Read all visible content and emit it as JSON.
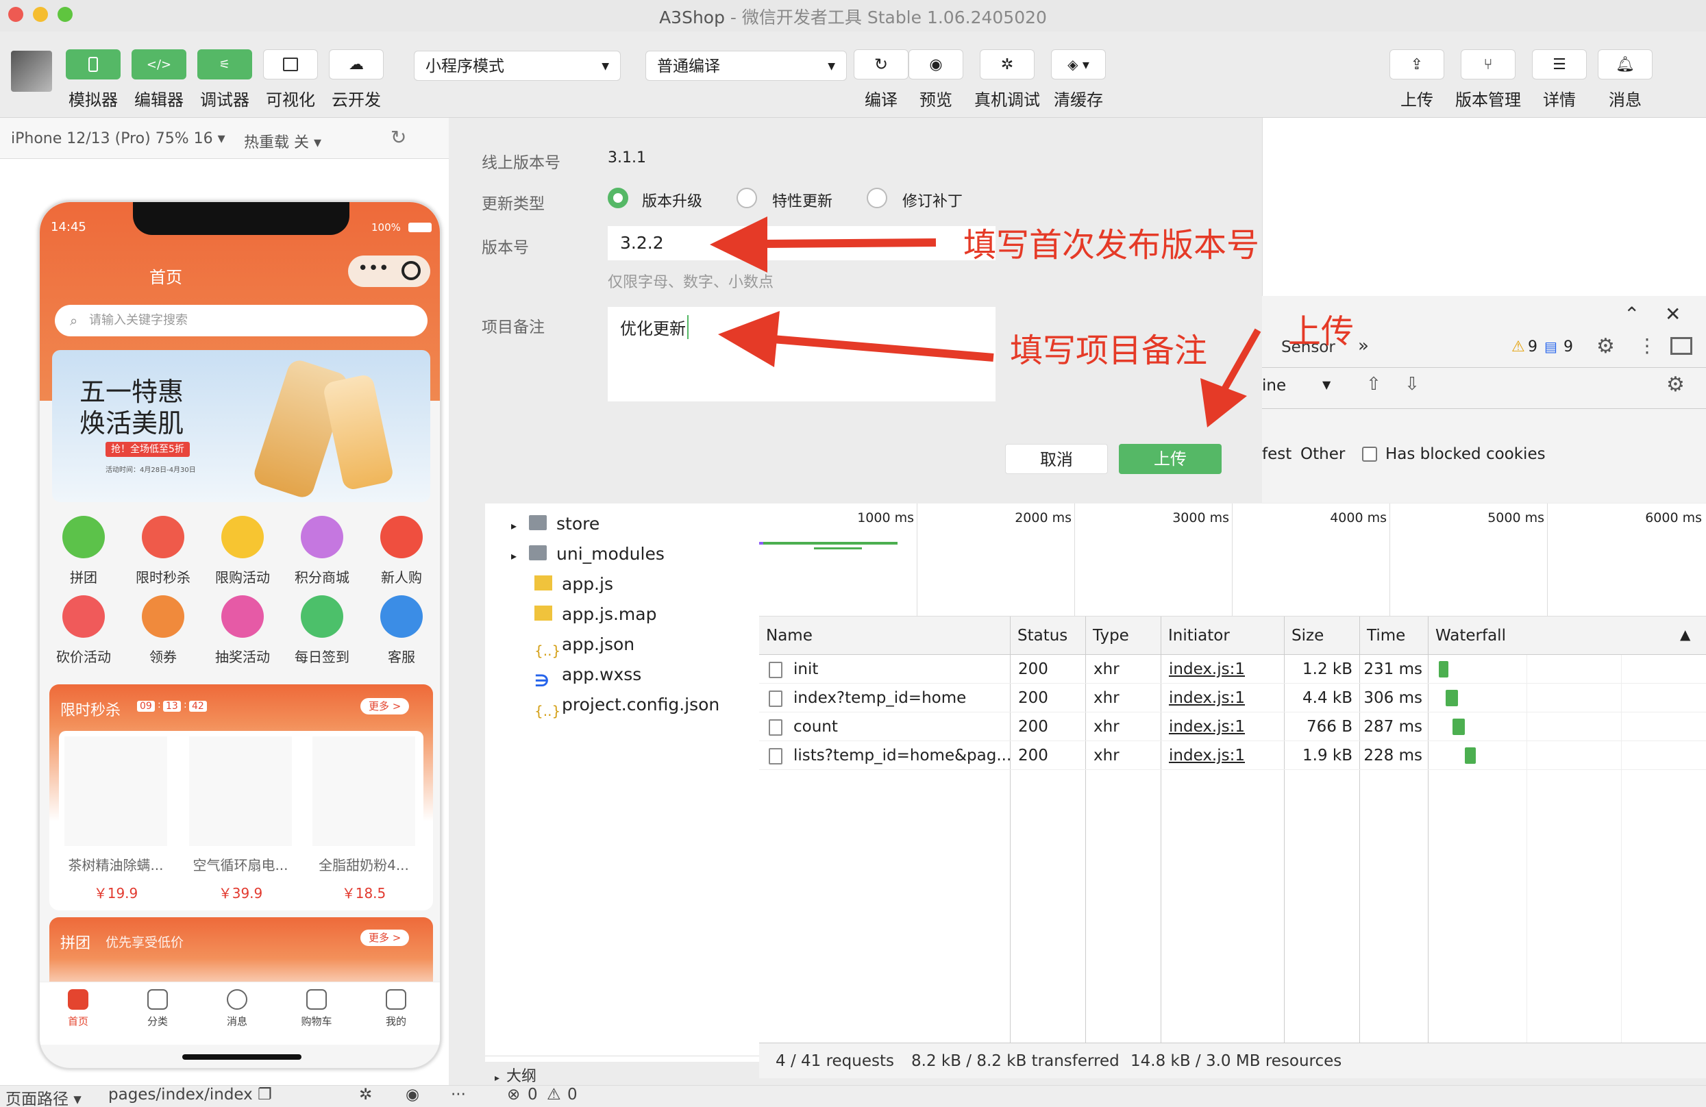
{
  "window": {
    "app_name": "A3Shop",
    "title_rest": "微信开发者工具 Stable 1.06.2405020"
  },
  "toolbar": {
    "left": [
      {
        "label": "模拟器"
      },
      {
        "label": "编辑器"
      },
      {
        "label": "调试器"
      },
      {
        "label": "可视化"
      },
      {
        "label": "云开发"
      }
    ],
    "mode_select": "小程序模式",
    "compile_select": "普通编译",
    "mid": [
      {
        "label": "编译"
      },
      {
        "label": "预览"
      },
      {
        "label": "真机调试"
      },
      {
        "label": "清缓存"
      }
    ],
    "right": [
      {
        "label": "上传"
      },
      {
        "label": "版本管理"
      },
      {
        "label": "详情"
      },
      {
        "label": "消息"
      }
    ]
  },
  "simulator": {
    "device": "iPhone 12/13 (Pro) 75% 16",
    "hot_reload": "热重载 关",
    "status_time": "14:45",
    "battery": "100%",
    "page_title": "首页",
    "search_placeholder": "请输入关键字搜索",
    "banner": {
      "line1": "五一特惠",
      "line2": "焕活美肌",
      "tag": "抢！全场低至5折",
      "date": "活动时间：4月28日-4月30日"
    },
    "icons": [
      {
        "label": "拼团",
        "color": "#5cc24a"
      },
      {
        "label": "限时秒杀",
        "color": "#ef5a4a"
      },
      {
        "label": "限购活动",
        "color": "#f7c531"
      },
      {
        "label": "积分商城",
        "color": "#c577e0"
      },
      {
        "label": "新人购",
        "color": "#ef4f3f"
      },
      {
        "label": "砍价活动",
        "color": "#f05a5a"
      },
      {
        "label": "领券",
        "color": "#f08a3c"
      },
      {
        "label": "抽奖活动",
        "color": "#e65aa6"
      },
      {
        "label": "每日签到",
        "color": "#4cc06a"
      },
      {
        "label": "客服",
        "color": "#3b8de6"
      }
    ],
    "flash_sale": {
      "title": "限时秒杀",
      "timer": [
        "09",
        "13",
        "42"
      ],
      "more": "更多 >",
      "products": [
        {
          "name": "茶树精油除螨...",
          "price": "￥19.9"
        },
        {
          "name": "空气循环扇电...",
          "price": "￥39.9"
        },
        {
          "name": "全脂甜奶粉4...",
          "price": "￥18.5"
        }
      ]
    },
    "group_buy": {
      "title": "拼团",
      "subtitle": "优先享受低价",
      "more": "更多 >"
    },
    "tabs": [
      {
        "label": "首页"
      },
      {
        "label": "分类"
      },
      {
        "label": "消息"
      },
      {
        "label": "购物车"
      },
      {
        "label": "我的"
      }
    ]
  },
  "dialog": {
    "online_version_label": "线上版本号",
    "online_version_value": "3.1.1",
    "update_type_label": "更新类型",
    "update_types": [
      "版本升级",
      "特性更新",
      "修订补丁"
    ],
    "selected_update_type": "版本升级",
    "version_label": "版本号",
    "version_value": "3.2.2",
    "version_hint": "仅限字母、数字、小数点",
    "note_label": "项目备注",
    "note_value": "优化更新",
    "cancel": "取消",
    "upload": "上传"
  },
  "annotations": {
    "version": "填写首次发布版本号",
    "note": "填写项目备注",
    "upload": "上传"
  },
  "devtools": {
    "tab_partial": "Sensor",
    "warnings": "9",
    "infos": "9",
    "throttle_partial": "ine",
    "filter_partial": "fest",
    "filter_other": "Other",
    "blocked_cookies": "Has blocked cookies",
    "timeline_ticks": [
      "1000 ms",
      "2000 ms",
      "3000 ms",
      "4000 ms",
      "5000 ms",
      "6000 ms"
    ],
    "columns": [
      "Name",
      "Status",
      "Type",
      "Initiator",
      "Size",
      "Time",
      "Waterfall"
    ],
    "rows": [
      {
        "name": "init",
        "status": "200",
        "type": "xhr",
        "initiator": "index.js:1",
        "size": "1.2 kB",
        "time": "231 ms"
      },
      {
        "name": "index?temp_id=home",
        "status": "200",
        "type": "xhr",
        "initiator": "index.js:1",
        "size": "4.4 kB",
        "time": "306 ms"
      },
      {
        "name": "count",
        "status": "200",
        "type": "xhr",
        "initiator": "index.js:1",
        "size": "766 B",
        "time": "287 ms"
      },
      {
        "name": "lists?temp_id=home&pag...",
        "status": "200",
        "type": "xhr",
        "initiator": "index.js:1",
        "size": "1.9 kB",
        "time": "228 ms"
      }
    ],
    "summary": {
      "requests": "4 / 41 requests",
      "transferred": "8.2 kB / 8.2 kB transferred",
      "resources": "14.8 kB / 3.0 MB resources"
    }
  },
  "files": [
    {
      "name": "store",
      "kind": "folder"
    },
    {
      "name": "uni_modules",
      "kind": "folder"
    },
    {
      "name": "app.js",
      "kind": "js"
    },
    {
      "name": "app.js.map",
      "kind": "js"
    },
    {
      "name": "app.json",
      "kind": "json"
    },
    {
      "name": "app.wxss",
      "kind": "wxss"
    },
    {
      "name": "project.config.json",
      "kind": "json"
    }
  ],
  "outline_label": "大纲",
  "statusbar": {
    "path_label": "页面路径",
    "path": "pages/index/index",
    "errors": "0",
    "warnings": "0"
  }
}
